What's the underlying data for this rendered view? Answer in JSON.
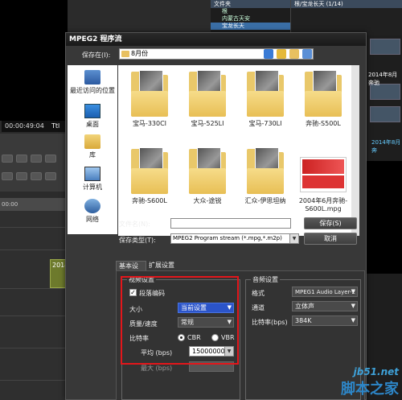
{
  "background": {
    "timecode": "00:00:49:04",
    "timeline_label": "Ttl",
    "ruler_label": "00:00",
    "clip_label": "2014",
    "folder_panel_title": "文件夹",
    "folder_root": "根",
    "folder_items": [
      "内蒙古天安",
      "宝龙长天"
    ],
    "thumb_panel_title": "根/宝龙长天 (1/14)",
    "side_label": "2014年8月奔驰",
    "side_label2": "2014年8月奔"
  },
  "dialog": {
    "title": "MPEG2 程序流",
    "look_in_label": "保存在(I):",
    "look_in_value": "8月份",
    "places": [
      {
        "label": "最近访问的位置",
        "icon": "recent-icon"
      },
      {
        "label": "桌面",
        "icon": "desktop-icon"
      },
      {
        "label": "库",
        "icon": "library-icon"
      },
      {
        "label": "计算机",
        "icon": "computer-icon"
      },
      {
        "label": "网络",
        "icon": "network-icon"
      }
    ],
    "files": [
      {
        "name": "宝马-330CI",
        "kind": "folder"
      },
      {
        "name": "宝马-525LI",
        "kind": "folder"
      },
      {
        "name": "宝马-730LI",
        "kind": "folder"
      },
      {
        "name": "奔驰-S500L",
        "kind": "folder"
      },
      {
        "name": "奔驰-S600L",
        "kind": "folder"
      },
      {
        "name": "大众-途锐",
        "kind": "folder"
      },
      {
        "name": "汇众-伊思坦纳",
        "kind": "folder"
      },
      {
        "name": "2004年6月奔驰-S600L.mpg",
        "kind": "video"
      }
    ],
    "filename_label": "文件名(N):",
    "filename_value": "",
    "filetype_label": "保存类型(T):",
    "filetype_value": "MPEG2 Program stream (*.mpg,*.m2p)",
    "save_button": "保存(S)",
    "cancel_button": "取消",
    "tabs": [
      "基本设置",
      "扩展设置"
    ],
    "video_group_title": "视频设置",
    "field_order_label": "段落编码",
    "field_order_checked": true,
    "size_label": "大小",
    "size_value": "当前设置",
    "quality_label": "质量/速度",
    "quality_value": "常规",
    "bitrate_label": "比特率",
    "cbr_label": "CBR",
    "vbr_label": "VBR",
    "bitrate_mode": "CBR",
    "avg_label": "平均 (bps)",
    "avg_value": "15000000",
    "max_label": "最大 (bps)",
    "max_value": "",
    "audio_group_title": "音频设置",
    "format_label": "格式",
    "format_value": "MPEG1 Audio Layer-2",
    "channel_label": "通道",
    "channel_value": "立体声",
    "sample_label": "比特率(bps)",
    "sample_value": "384K"
  },
  "watermark": {
    "url": "jb51.net",
    "name": "脚本之家"
  },
  "colors": {
    "highlight": "#e3161b",
    "selected_blue": "#2b54c9",
    "folder_yellow": "#e9c86a"
  }
}
